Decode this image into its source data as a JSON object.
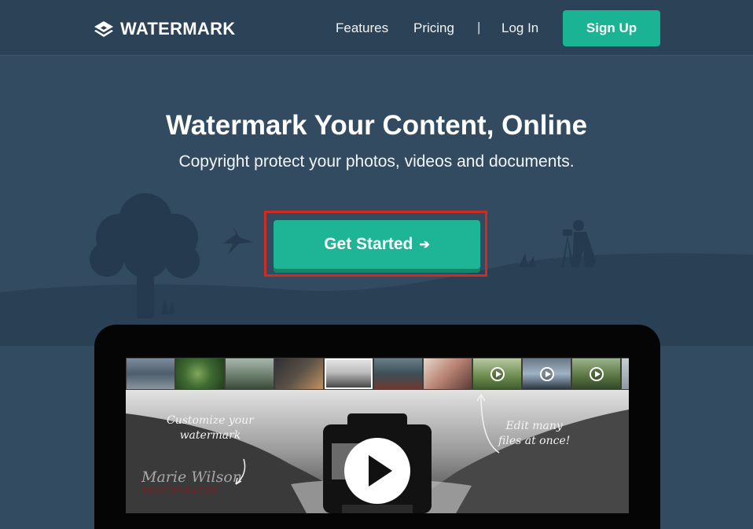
{
  "nav": {
    "brand": "WATERMARK",
    "links": [
      "Features",
      "Pricing",
      "Log In"
    ],
    "separator": "|",
    "signup_label": "Sign Up"
  },
  "hero": {
    "title": "Watermark Your Content, Online",
    "subtitle": "Copyright protect your photos, videos and documents.",
    "cta_label": "Get Started",
    "cta_icon": "arrow-right-icon"
  },
  "demo": {
    "note_left_line1": "Customize your",
    "note_left_line2": "watermark",
    "note_right_line1": "Edit many",
    "note_right_line2": "files at once!",
    "signature_name": "Marie Wilson",
    "signature_sub": "PHOTOGRAPHY",
    "thumbnails": [
      {
        "kind": "photo"
      },
      {
        "kind": "photo"
      },
      {
        "kind": "photo"
      },
      {
        "kind": "photo"
      },
      {
        "kind": "photo",
        "selected": true
      },
      {
        "kind": "photo"
      },
      {
        "kind": "photo"
      },
      {
        "kind": "video"
      },
      {
        "kind": "video"
      },
      {
        "kind": "video"
      },
      {
        "kind": "photo"
      }
    ]
  },
  "colors": {
    "background": "#334b61",
    "navbar": "#2c4257",
    "accent": "#1ab394",
    "highlight_border": "#d12a1f",
    "silhouette": "#253a4e"
  }
}
